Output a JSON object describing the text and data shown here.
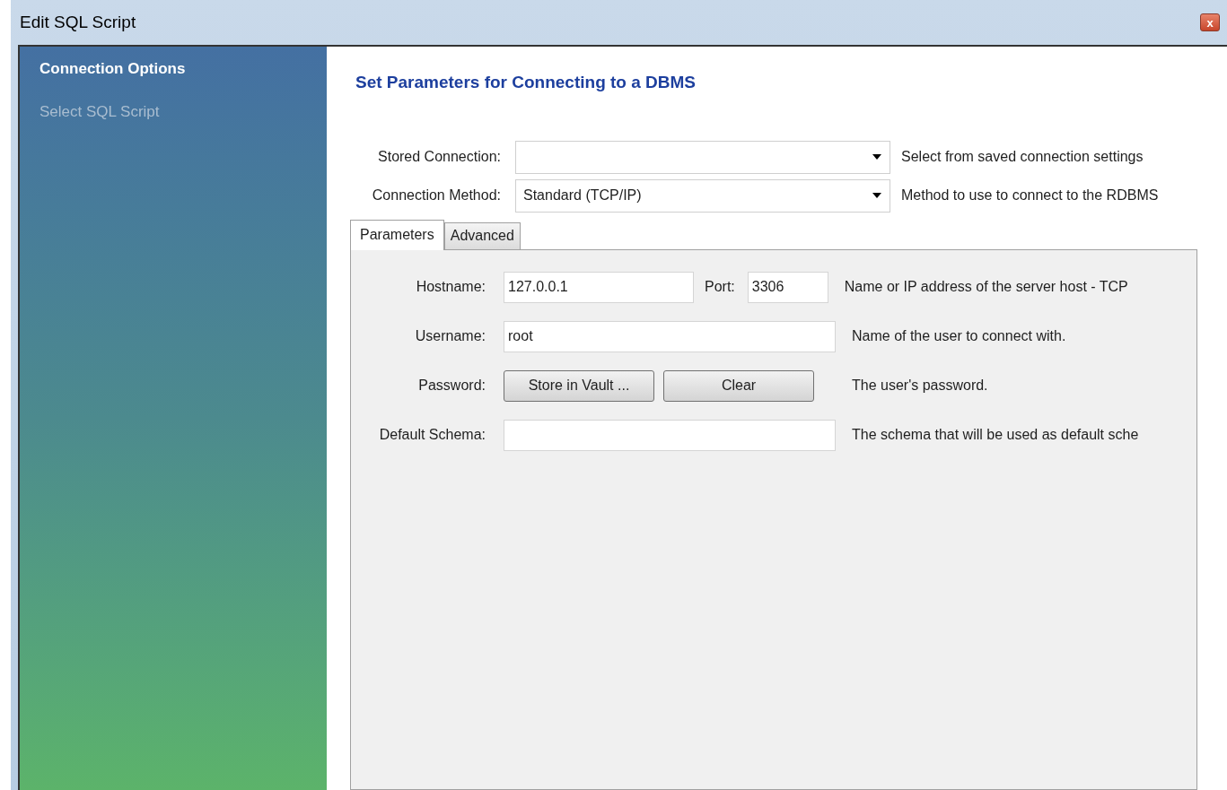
{
  "window": {
    "title": "Edit SQL Script",
    "close": "x"
  },
  "sidebar": {
    "items": [
      {
        "label": "Connection Options",
        "selected": true
      },
      {
        "label": "Select SQL Script",
        "selected": false
      }
    ]
  },
  "heading": "Set Parameters for Connecting to a DBMS",
  "top_fields": [
    {
      "label": "Stored Connection:",
      "hint": "Select from saved connection settings"
    },
    {
      "label": "Connection Method:",
      "value": "Standard (TCP/IP)",
      "hint": "Method to use to connect to the RDBMS"
    }
  ],
  "tabs": [
    {
      "label": "Parameters",
      "selected": true
    },
    {
      "label": "Advanced",
      "selected": false
    }
  ],
  "hostname": {
    "label": "Hostname:",
    "value": "127.0.0.1",
    "port_label": "Port:",
    "port": "3306",
    "hint": "Name or IP address of the server host - TCP"
  },
  "username": {
    "label": "Username:",
    "value": "root",
    "hint": "Name of the user to connect with."
  },
  "password": {
    "label": "Password:",
    "buttons": [
      "Store in Vault ...",
      "Clear"
    ],
    "hint": "The user's password."
  },
  "default_schema": {
    "label": "Default Schema:",
    "hint": "The schema that will be used as default sche"
  }
}
